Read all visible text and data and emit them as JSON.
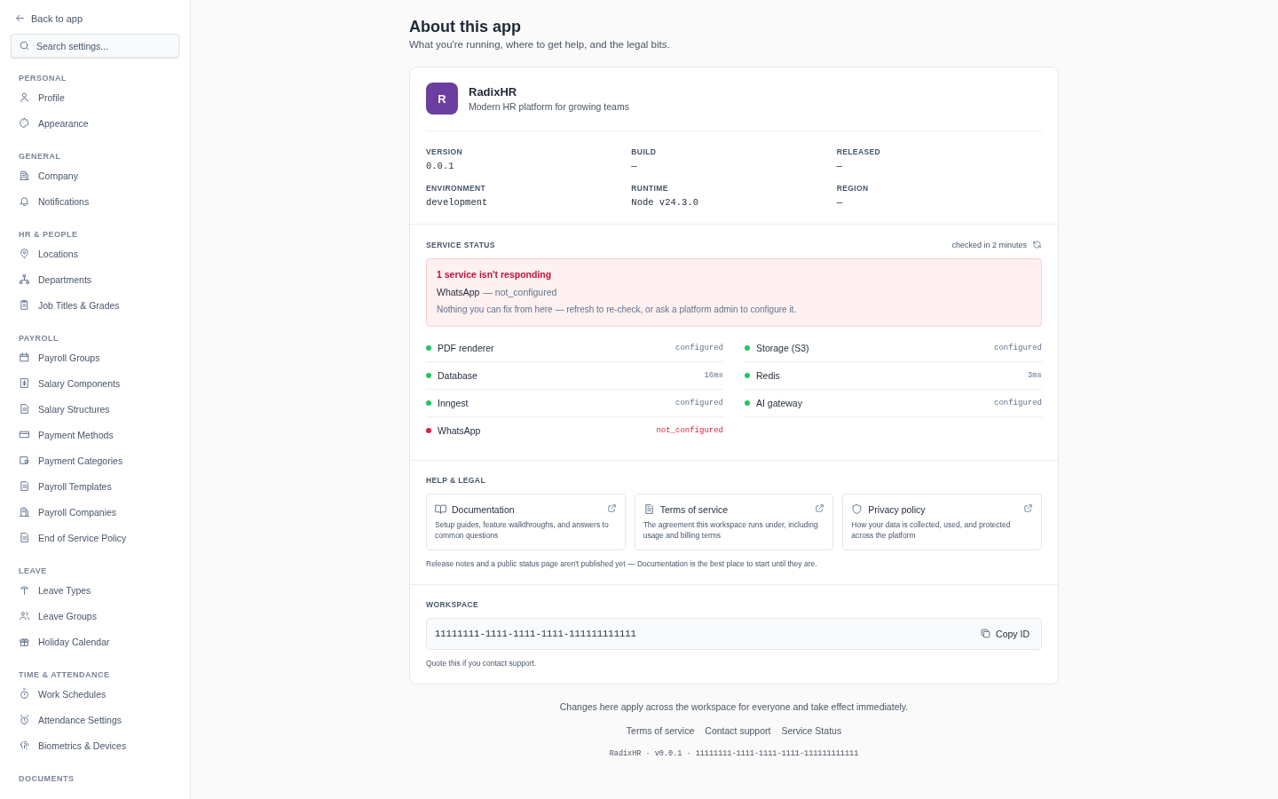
{
  "sidebar": {
    "back_link": "Back to app",
    "search": {
      "placeholder": "Search settings..."
    },
    "sections": [
      {
        "title": "PERSONAL",
        "items": [
          {
            "label": "Profile",
            "selected": false
          },
          {
            "label": "Appearance",
            "selected": false
          }
        ]
      },
      {
        "title": "GENERAL",
        "items": [
          {
            "label": "Company",
            "selected": false
          },
          {
            "label": "Notifications",
            "selected": false
          }
        ]
      },
      {
        "title": "HR & PEOPLE",
        "items": [
          {
            "label": "Locations",
            "selected": false
          },
          {
            "label": "Departments",
            "selected": false
          },
          {
            "label": "Job Titles & Grades",
            "selected": false
          }
        ]
      },
      {
        "title": "PAYROLL",
        "items": [
          {
            "label": "Payroll Groups",
            "selected": false
          },
          {
            "label": "Salary Components",
            "selected": false
          },
          {
            "label": "Salary Structures",
            "selected": false
          },
          {
            "label": "Payment Methods",
            "selected": false
          },
          {
            "label": "Payment Categories",
            "selected": false
          },
          {
            "label": "Payroll Templates",
            "selected": false
          },
          {
            "label": "Payroll Companies",
            "selected": false
          },
          {
            "label": "End of Service Policy",
            "selected": false
          }
        ]
      },
      {
        "title": "LEAVE",
        "items": [
          {
            "label": "Leave Types",
            "selected": false
          },
          {
            "label": "Leave Groups",
            "selected": false
          },
          {
            "label": "Holiday Calendar",
            "selected": false
          }
        ]
      },
      {
        "title": "TIME & ATTENDANCE",
        "items": [
          {
            "label": "Work Schedules",
            "selected": false
          },
          {
            "label": "Attendance Settings",
            "selected": false
          },
          {
            "label": "Biometrics & Devices",
            "selected": false
          }
        ]
      },
      {
        "title": "DOCUMENTS"
      }
    ]
  },
  "page": {
    "title": "About this app",
    "subtitle": "What you're running, where to get help, and the legal bits."
  },
  "app": {
    "logo_letter": "R",
    "name": "RadixHR",
    "tagline": "Modern HR platform for growing teams",
    "facts": [
      {
        "label": "VERSION",
        "value": "0.0.1"
      },
      {
        "label": "BUILD",
        "value": "—"
      },
      {
        "label": "RELEASED",
        "value": "—"
      },
      {
        "label": "ENVIRONMENT",
        "value": "development"
      },
      {
        "label": "RUNTIME",
        "value": "Node v24.3.0"
      },
      {
        "label": "REGION",
        "value": "—"
      }
    ]
  },
  "service_status": {
    "title": "SERVICE STATUS",
    "checked": "checked in 2 minutes",
    "alert": {
      "title": "1 service isn't responding",
      "service": "WhatsApp",
      "detail": "— not_configured",
      "note": "Nothing you can fix from here — refresh to re-check, or ask a platform admin to configure it."
    },
    "services": [
      {
        "name": "PDF renderer",
        "value": "configured",
        "failing": false,
        "color": "#22c55e"
      },
      {
        "name": "Storage (S3)",
        "value": "configured",
        "failing": false,
        "color": "#22c55e"
      },
      {
        "name": "Database",
        "value": "16ms",
        "failing": false,
        "color": "#22c55e"
      },
      {
        "name": "Redis",
        "value": "3ms",
        "failing": false,
        "color": "#22c55e"
      },
      {
        "name": "Inngest",
        "value": "configured",
        "failing": false,
        "color": "#22c55e"
      },
      {
        "name": "AI gateway",
        "value": "configured",
        "failing": false,
        "color": "#22c55e"
      },
      {
        "name": "WhatsApp",
        "value": "not_configured",
        "failing": true,
        "color": "#e11d48"
      }
    ]
  },
  "help_legal": {
    "title": "HELP & LEGAL",
    "links": [
      {
        "kind": "book",
        "title": "Documentation",
        "description": "Setup guides, feature walkthroughs, and answers to common questions"
      },
      {
        "kind": "document",
        "title": "Terms of service",
        "description": "The agreement this workspace runs under, including usage and billing terms"
      },
      {
        "kind": "shield",
        "title": "Privacy policy",
        "description": "How your data is collected, used, and protected across the platform"
      }
    ],
    "note": "Release notes and a public status page aren't published yet — Documentation is the best place to start until they are."
  },
  "workspace": {
    "title": "WORKSPACE",
    "id": "11111111-1111-1111-1111-111111111111",
    "copy_button": "Copy ID",
    "hint": "Quote this if you contact support."
  },
  "footer": {
    "notice": "Changes here apply across the workspace for everyone and take effect immediately.",
    "links": [
      "Terms of service",
      "Contact support",
      "Service Status"
    ],
    "meta": "RadixHR · v0.0.1 · 11111111-1111-1111-1111-111111111111"
  }
}
